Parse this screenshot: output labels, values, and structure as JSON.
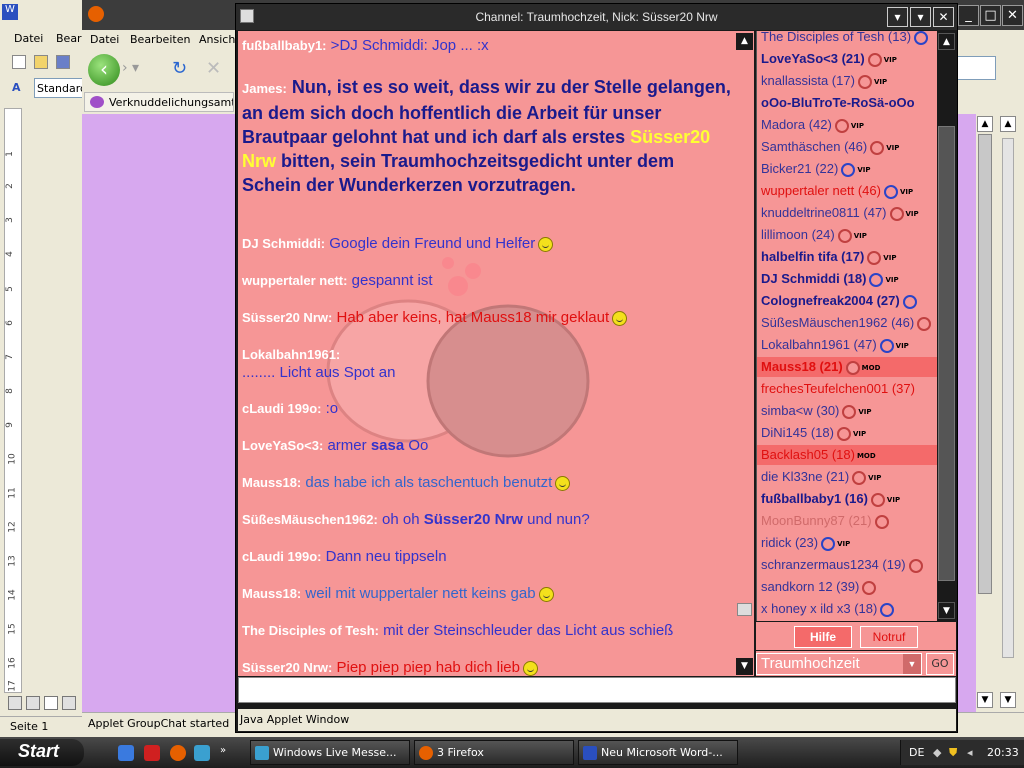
{
  "word": {
    "menu": [
      "Datei",
      "Bear"
    ],
    "style_value": "Standard",
    "ruler_numbers": [
      "1",
      "2",
      "3",
      "4",
      "5",
      "6",
      "7",
      "8",
      "9",
      "10",
      "11",
      "12",
      "13",
      "14",
      "15",
      "16",
      "17"
    ],
    "status_page": "Seite  1"
  },
  "firefox": {
    "menu": [
      "Datei",
      "Bearbeiten",
      "Ansicht"
    ],
    "tab_label": "Verknuddelichungsamt...",
    "status": "Applet GroupChat started"
  },
  "chat": {
    "title": "Channel: Traumhochzeit,  Nick: Süsser20 Nrw",
    "messages": [
      {
        "nick": "fußballbaby1:",
        "text": " >DJ Schmiddi: Jop ... :x"
      },
      {
        "nick": "James:",
        "pre": " Nun, ist es so weit, dass wir zu der Stelle gelangen, an dem sich doch hoffentlich die Arbeit für unser Brautpaar gelohnt hat und ich darf als erstes ",
        "highlight": "Süsser20 Nrw",
        "post": " bitten, sein Traumhochzeitsgedicht unter dem Schein der Wunderkerzen vorzutragen."
      },
      {
        "nick": "DJ Schmiddi:",
        "text": " Google dein Freund und Helfer"
      },
      {
        "nick": "wuppertaler nett:",
        "text": " gespannt ist"
      },
      {
        "nick": "Süsser20 Nrw:",
        "text": " Hab aber keins, hat Mauss18  mir geklaut"
      },
      {
        "nick": "Lokalbahn1961:",
        "text": "........ Licht aus Spot an"
      },
      {
        "nick": "cLaudi 199o:",
        "text": " :o"
      },
      {
        "nick": "LoveYaSo<3:",
        "pre": " armer ",
        "bold": "sasa",
        "post": " Oo"
      },
      {
        "nick": "Mauss18:",
        "text": " das habe ich als taschentuch benutzt"
      },
      {
        "nick": "SüßesMäuschen1962:",
        "pre": " oh oh ",
        "bold": "Süsser20 Nrw",
        "post": "  und nun?"
      },
      {
        "nick": "cLaudi 199o:",
        "text": " Dann neu tippseln"
      },
      {
        "nick": "Mauss18:",
        "text": " weil mit wuppertaler nett keins gab"
      },
      {
        "nick": "The Disciples of Tesh:",
        "text": " mit der Steinschleuder das Licht aus schieß"
      },
      {
        "nick": "Süsser20 Nrw:",
        "text": " Piep piep piep hab dich lieb"
      }
    ],
    "users": [
      "The Disciples of Tesh (13)",
      "LoveYaSo<3 (21)",
      "knallassista (17)",
      "oOo-BluTroTe-RoSä-oOo",
      "Madora (42)",
      "Samthäschen (46)",
      "Bicker21 (22)",
      "wuppertaler nett (46)",
      "knuddeltrine0811 (47)",
      "lillimoon (24)",
      "halbelfin tifa (17)",
      "DJ Schmiddi (18)",
      "Colognefreak2004 (27)",
      "SüßesMäuschen1962 (46)",
      "Lokalbahn1961 (47)",
      "Mauss18 (21)",
      "frechesTeufelchen001 (37)",
      "simba<w (30)",
      "DiNi145 (18)",
      "Backlash05 (18)",
      "die Kl33ne (21)",
      "fußballbaby1 (16)",
      "MoonBunny87 (21)",
      "ridick (23)",
      "schranzermaus1234 (19)",
      "sandkorn 12 (39)",
      "x honey x ild x3 (18)"
    ],
    "badges": {
      "vip": "VIP",
      "mod": "MOD"
    },
    "help_button": "Hilfe",
    "emergency_button": "Notruf",
    "room_value": "Traumhochzeit",
    "go_button": "GO",
    "applet_status": "Java Applet Window"
  },
  "taskbar": {
    "start": "Start",
    "tasks": [
      "Windows Live Messe...",
      "3 Firefox",
      "Neu Microsoft Word-..."
    ],
    "lang": "DE",
    "clock": "20:33"
  },
  "colors": {
    "chat_bg": "#f69696",
    "nick_white": "#ffffff",
    "text_blue": "#333399",
    "text_red": "#e01010",
    "highlight_yellow": "#ffff33",
    "firefox_content": "#d7a8ef"
  }
}
